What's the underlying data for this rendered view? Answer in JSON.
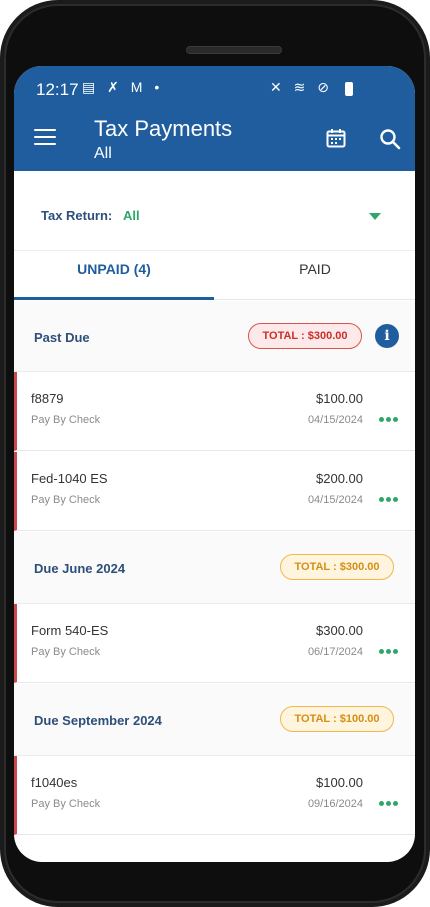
{
  "status_bar": {
    "time": "12:17",
    "left_icons": [
      "calendar-app-icon",
      "missed-call-icon",
      "gmail-icon",
      "dot-icon"
    ],
    "right_icons": [
      "mute-icon",
      "wifi-icon",
      "do-not-disturb-icon",
      "battery-icon"
    ]
  },
  "header": {
    "title": "Tax Payments",
    "subtitle": "All"
  },
  "filter": {
    "label": "Tax Return:",
    "value": "All"
  },
  "tabs": [
    {
      "label": "UNPAID (4)",
      "active": true
    },
    {
      "label": "PAID",
      "active": false
    }
  ],
  "sections": [
    {
      "title": "Past Due",
      "total": "TOTAL : $300.00",
      "style": "red",
      "show_info": true,
      "rows": [
        {
          "name": "f8879",
          "method": "Pay By Check",
          "amount": "$100.00",
          "date": "04/15/2024"
        },
        {
          "name": "Fed-1040 ES",
          "method": "Pay By Check",
          "amount": "$200.00",
          "date": "04/15/2024"
        }
      ]
    },
    {
      "title": "Due June 2024",
      "total": "TOTAL : $300.00",
      "style": "yellow",
      "show_info": false,
      "rows": [
        {
          "name": "Form 540-ES",
          "method": "Pay By Check",
          "amount": "$300.00",
          "date": "06/17/2024"
        }
      ]
    },
    {
      "title": "Due September 2024",
      "total": "TOTAL : $100.00",
      "style": "yellow",
      "show_info": false,
      "rows": [
        {
          "name": "f1040es",
          "method": "Pay By Check",
          "amount": "$100.00",
          "date": "09/16/2024"
        }
      ]
    }
  ],
  "colors": {
    "primary": "#1f5d9e",
    "accent_green": "#2fa66a",
    "past_due_red": "#c9494c",
    "due_yellow": "#f0b84a"
  }
}
